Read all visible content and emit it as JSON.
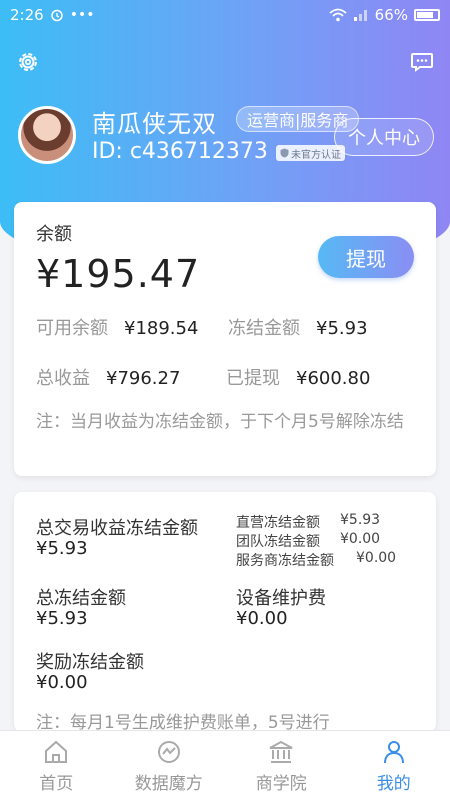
{
  "status_bar": {
    "time": "2:26",
    "battery": "66%"
  },
  "colors": {
    "accent": "#3a8ee8",
    "gradient_start": "#3cbdf5",
    "gradient_end": "#8f86f4"
  },
  "icons": {
    "settings": "gear-icon",
    "message": "message-icon"
  },
  "profile": {
    "nickname": "南瓜侠无双",
    "role": "运营商|服务商",
    "id": "ID: c436712373",
    "official_badge": "未官方认证",
    "center_button": "个人中心"
  },
  "balance": {
    "title": "余额",
    "amount": "¥195.47",
    "withdraw_label": "提现",
    "available_label": "可用余额",
    "available_value": "¥189.54",
    "frozen_label": "冻结金额",
    "frozen_value": "¥5.93",
    "total_income_label": "总收益",
    "total_income_value": "¥796.27",
    "withdrawn_label": "已提现",
    "withdrawn_value": "¥600.80",
    "note": "注：当月收益为冻结金额，于下个月5号解除冻结"
  },
  "frozen": {
    "trade_title": "总交易收益冻结金额",
    "trade_value": "¥5.93",
    "direct_label": "直营冻结金额",
    "direct_value": "¥5.93",
    "team_label": "团队冻结金额",
    "team_value": "¥0.00",
    "service_label": "服务商冻结金额",
    "service_value": "¥0.00",
    "total_title": "总冻结金额",
    "total_value": "¥5.93",
    "maintenance_title": "设备维护费",
    "maintenance_value": "¥0.00",
    "reward_title": "奖励冻结金额",
    "reward_value": "¥0.00",
    "note": "注：每月1号生成维护费账单，5号进行"
  },
  "tabs": [
    {
      "label": "首页",
      "icon": "home-icon"
    },
    {
      "label": "数据魔方",
      "icon": "data-icon"
    },
    {
      "label": "商学院",
      "icon": "school-icon"
    },
    {
      "label": "我的",
      "icon": "user-icon",
      "active": true
    }
  ]
}
